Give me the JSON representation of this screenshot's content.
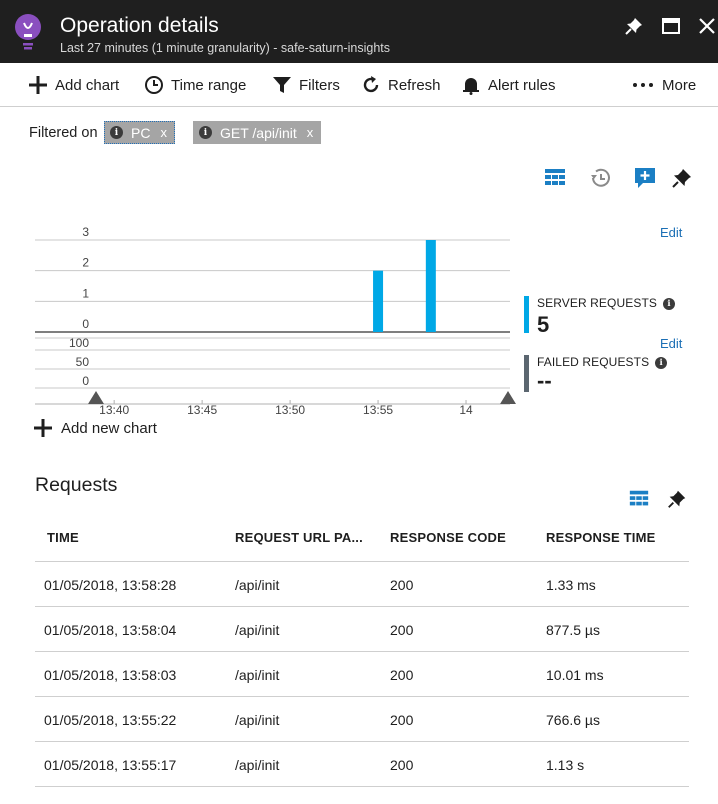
{
  "header": {
    "title": "Operation details",
    "subtitle": "Last 27 minutes (1 minute granularity) - safe-saturn-insights",
    "accent_color": "#8a4fbf"
  },
  "toolbar": {
    "add_chart": "Add chart",
    "time_range": "Time range",
    "filters": "Filters",
    "refresh": "Refresh",
    "alert_rules": "Alert rules",
    "more": "More"
  },
  "filters": {
    "label": "Filtered on",
    "chips": [
      {
        "text": "PC",
        "close": "x"
      },
      {
        "text": "GET /api/init",
        "close": "x"
      }
    ]
  },
  "chart": {
    "edit_label": "Edit",
    "add_new_chart": "Add new chart"
  },
  "chart_data": {
    "type": "bar",
    "x_ticks": [
      "13:40",
      "13:45",
      "13:50",
      "13:55",
      "14"
    ],
    "upper": {
      "ylim": [
        0,
        3
      ],
      "y_ticks": [
        "3",
        "2",
        "1",
        "0"
      ],
      "series": [
        {
          "name": "SERVER REQUESTS",
          "color": "#00a8e6",
          "points": [
            {
              "x": "13:55",
              "y": 2
            },
            {
              "x": "13:58",
              "y": 3
            }
          ]
        }
      ]
    },
    "lower": {
      "ylim": [
        0,
        100
      ],
      "y_ticks": [
        "100",
        "50",
        "0"
      ],
      "series": [
        {
          "name": "FAILED REQUESTS",
          "color": "#5b6670",
          "points": []
        }
      ]
    }
  },
  "legend": {
    "server": {
      "label": "SERVER REQUESTS",
      "value": "5",
      "color": "#00a8e6",
      "info": "i"
    },
    "failed": {
      "label": "FAILED REQUESTS",
      "value": "--",
      "color": "#5b6670",
      "info": "i"
    }
  },
  "requests": {
    "title": "Requests",
    "columns": [
      "TIME",
      "REQUEST URL PA...",
      "RESPONSE CODE",
      "RESPONSE TIME"
    ],
    "rows": [
      [
        "01/05/2018, 13:58:28",
        "/api/init",
        "200",
        "1.33 ms"
      ],
      [
        "01/05/2018, 13:58:04",
        "/api/init",
        "200",
        "877.5 µs"
      ],
      [
        "01/05/2018, 13:58:03",
        "/api/init",
        "200",
        "10.01 ms"
      ],
      [
        "01/05/2018, 13:55:22",
        "/api/init",
        "200",
        "766.6 µs"
      ],
      [
        "01/05/2018, 13:55:17",
        "/api/init",
        "200",
        "1.13 s"
      ]
    ]
  }
}
